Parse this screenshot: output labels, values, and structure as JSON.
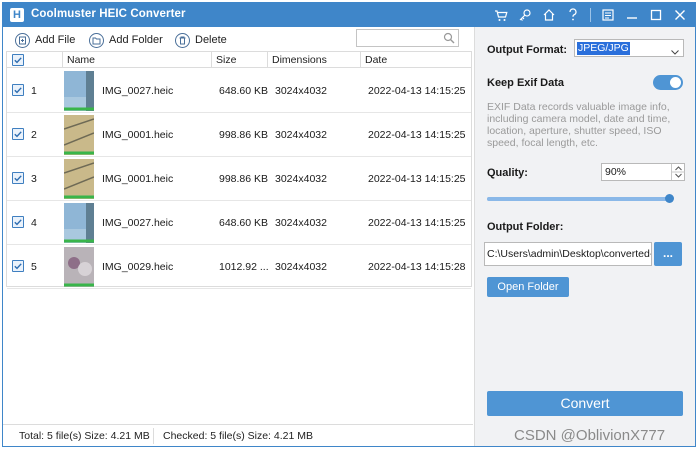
{
  "app": {
    "title": "Coolmuster HEIC Converter",
    "logo_letter": "H"
  },
  "titlebar_icons": [
    "cart-icon",
    "key-icon",
    "home-icon",
    "help-icon",
    "feedback-icon",
    "minimize-icon",
    "maximize-icon",
    "close-icon"
  ],
  "toolbar": {
    "add_file": "Add File",
    "add_folder": "Add Folder",
    "delete": "Delete",
    "search_placeholder": ""
  },
  "table": {
    "headers": {
      "name": "Name",
      "size": "Size",
      "dimensions": "Dimensions",
      "date": "Date"
    },
    "rows": [
      {
        "index": "1",
        "name": "IMG_0027.heic",
        "size": "648.60 KB",
        "dimensions": "3024x4032",
        "date": "2022-04-13 14:15:25",
        "checked": true,
        "thumb": "sky"
      },
      {
        "index": "2",
        "name": "IMG_0001.heic",
        "size": "998.86 KB",
        "dimensions": "3024x4032",
        "date": "2022-04-13 14:15:25",
        "checked": true,
        "thumb": "sand"
      },
      {
        "index": "3",
        "name": "IMG_0001.heic",
        "size": "998.86 KB",
        "dimensions": "3024x4032",
        "date": "2022-04-13 14:15:25",
        "checked": true,
        "thumb": "sand"
      },
      {
        "index": "4",
        "name": "IMG_0027.heic",
        "size": "648.60 KB",
        "dimensions": "3024x4032",
        "date": "2022-04-13 14:15:25",
        "checked": true,
        "thumb": "sky"
      },
      {
        "index": "5",
        "name": "IMG_0029.heic",
        "size": "1012.92 ...",
        "dimensions": "3024x4032",
        "date": "2022-04-13 14:15:28",
        "checked": true,
        "thumb": "cat"
      }
    ]
  },
  "status": {
    "total": "Total: 5 file(s) Size: 4.21 MB",
    "checked": "Checked: 5 file(s) Size: 4.21 MB"
  },
  "panel": {
    "output_format_label": "Output Format:",
    "output_format_value": "JPEG/JPG",
    "keep_exif_label": "Keep Exif Data",
    "keep_exif_on": true,
    "exif_description": "EXIF Data records valuable image info, including camera model, date and time, location, aperture, shutter speed, ISO speed, focal length, etc.",
    "quality_label": "Quality:",
    "quality_value": "90%",
    "quality_fraction": 0.98,
    "output_folder_label": "Output Folder:",
    "output_folder_path": "C:\\Users\\admin\\Desktop\\converted-",
    "browse_label": "...",
    "open_folder": "Open Folder",
    "convert": "Convert"
  },
  "colors": {
    "accent": "#3f86c9",
    "button": "#4f95d4",
    "panel_bg": "#f1f2f4"
  },
  "watermark": "CSDN @OblivionX777"
}
